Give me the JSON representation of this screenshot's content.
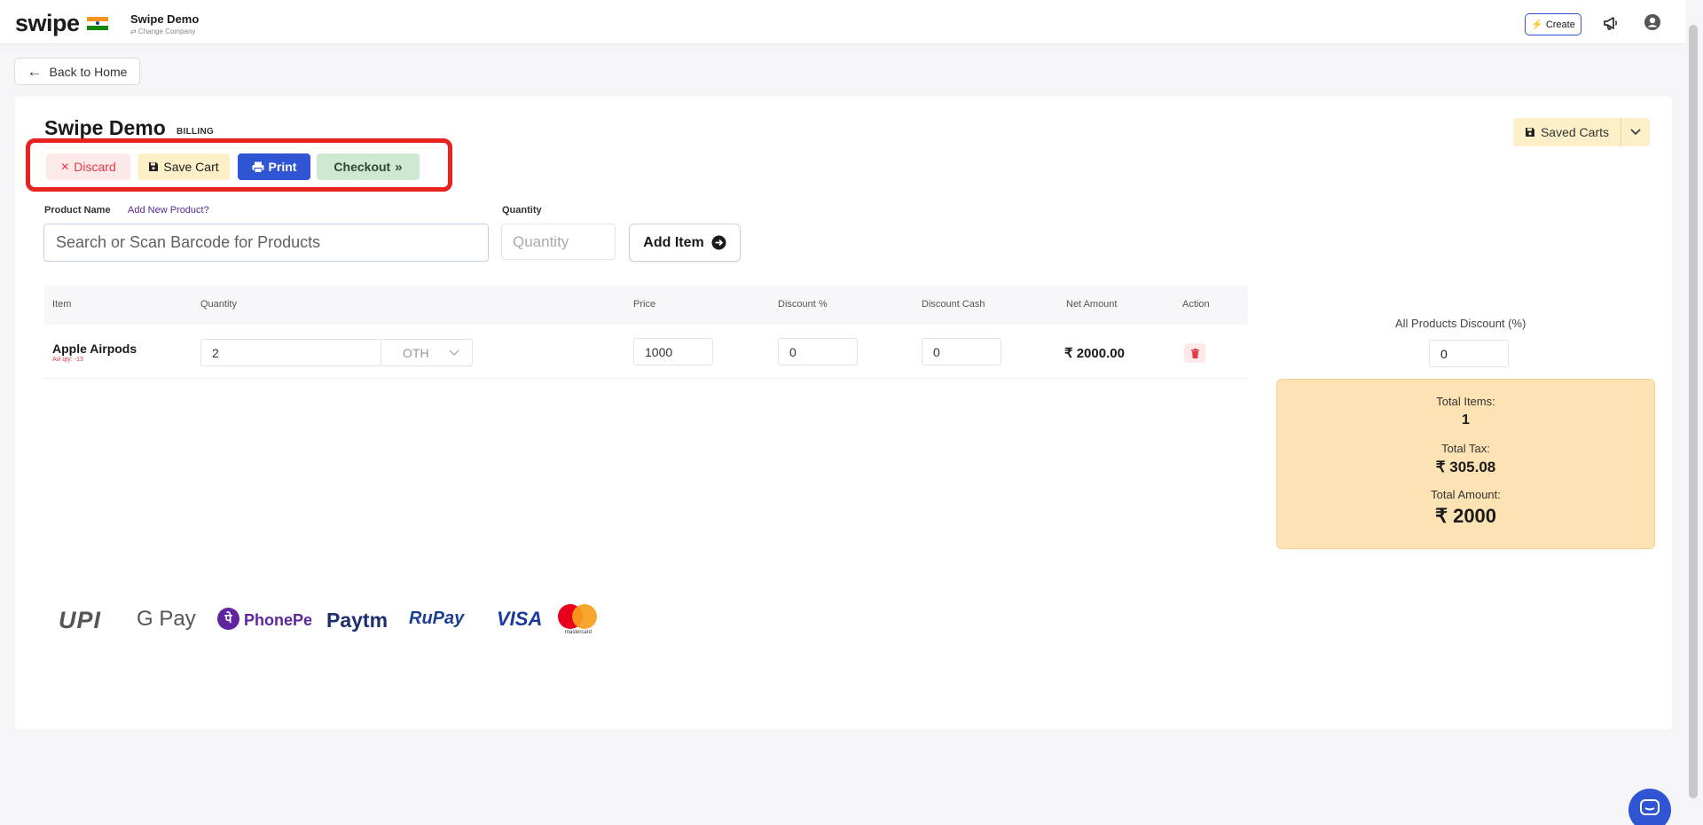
{
  "header": {
    "logo_text": "swipe",
    "company_name": "Swipe Demo",
    "change_company": "⇄ Change Company",
    "create_label": "Create"
  },
  "back_label": "Back to Home",
  "page": {
    "title": "Swipe Demo",
    "subtitle": "BILLING"
  },
  "actions": {
    "discard": "Discard",
    "save_cart": "Save Cart",
    "print": "Print",
    "checkout": "Checkout"
  },
  "saved_carts_label": "Saved Carts",
  "form": {
    "product_name_label": "Product Name",
    "add_new_product": "Add New Product?",
    "search_placeholder": "Search or Scan Barcode for Products",
    "quantity_label": "Quantity",
    "quantity_placeholder": "Quantity",
    "add_item": "Add Item"
  },
  "table": {
    "headers": [
      "Item",
      "Quantity",
      "Price",
      "Discount %",
      "Discount Cash",
      "Net Amount",
      "Action"
    ],
    "rows": [
      {
        "item": "Apple Airpods",
        "avl": "Avl qty: -13",
        "quantity": "2",
        "unit": "OTH",
        "price": "1000",
        "discount_pct": "0",
        "discount_cash": "0",
        "net_amount": "₹ 2000.00"
      }
    ]
  },
  "summary": {
    "all_products_discount_label": "All Products Discount (%)",
    "all_products_discount_value": "0",
    "total_items_label": "Total Items:",
    "total_items_value": "1",
    "total_tax_label": "Total Tax:",
    "total_tax_value": "₹ 305.08",
    "total_amount_label": "Total Amount:",
    "total_amount_value": "₹ 2000"
  },
  "payment_methods": [
    "UPI",
    "G Pay",
    "PhonePe",
    "Paytm",
    "RuPay",
    "VISA",
    "mastercard"
  ],
  "colors": {
    "primary": "#2f55d4",
    "danger": "#e53945",
    "highlight": "#e8231f",
    "summary_bg": "#fde3b3",
    "checkout_bg": "#cde9cf",
    "savecart_bg": "#fdf0c8"
  }
}
